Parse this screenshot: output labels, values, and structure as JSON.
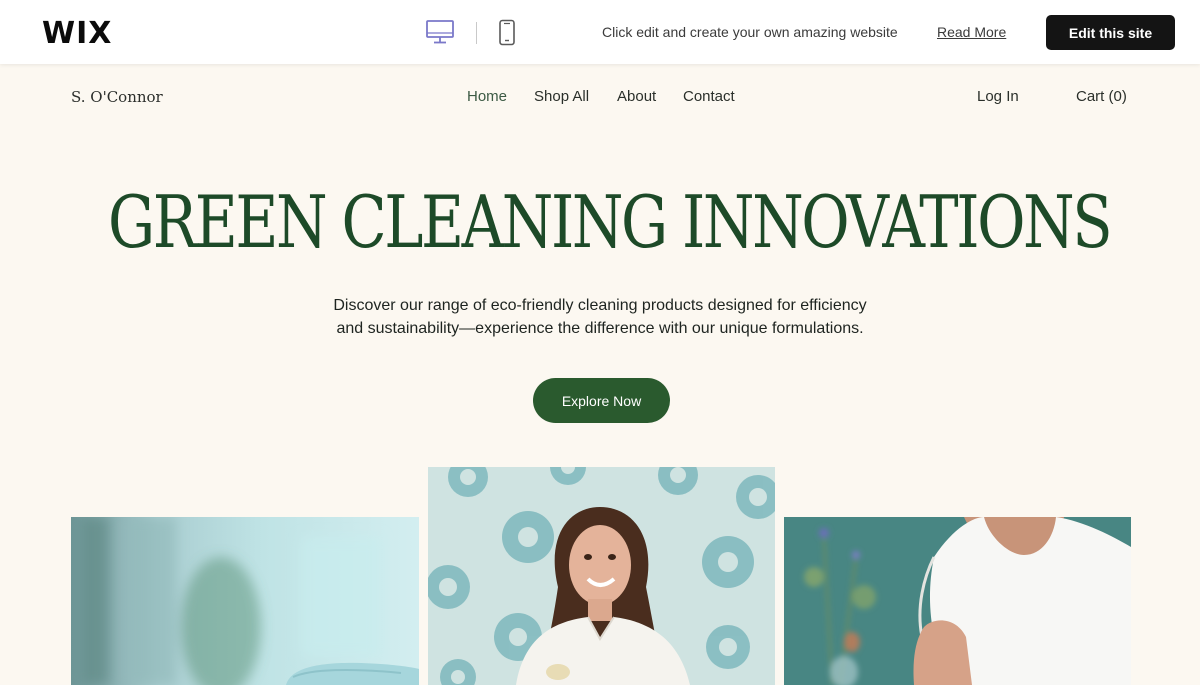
{
  "wix_bar": {
    "logo": "WIX",
    "desktop_icon": "desktop-icon",
    "mobile_icon": "mobile-icon",
    "message": "Click edit and create your own amazing website",
    "read_more": "Read More",
    "edit_button": "Edit this site",
    "accent_color": "#7a78c9"
  },
  "header": {
    "brand": "S. O'Connor",
    "nav": [
      "Home",
      "Shop All",
      "About",
      "Contact"
    ],
    "login": "Log In",
    "cart": "Cart (0)"
  },
  "hero": {
    "title": "GREEN CLEANING INNOVATIONS",
    "subtitle_line1": "Discover our range of eco-friendly cleaning products designed for efficiency",
    "subtitle_line2": "and sustainability—experience the difference with our unique formulations.",
    "cta": "Explore Now"
  },
  "colors": {
    "background": "#fcf8f1",
    "title_green": "#1d4a28",
    "button_green": "#2a5a2e"
  }
}
